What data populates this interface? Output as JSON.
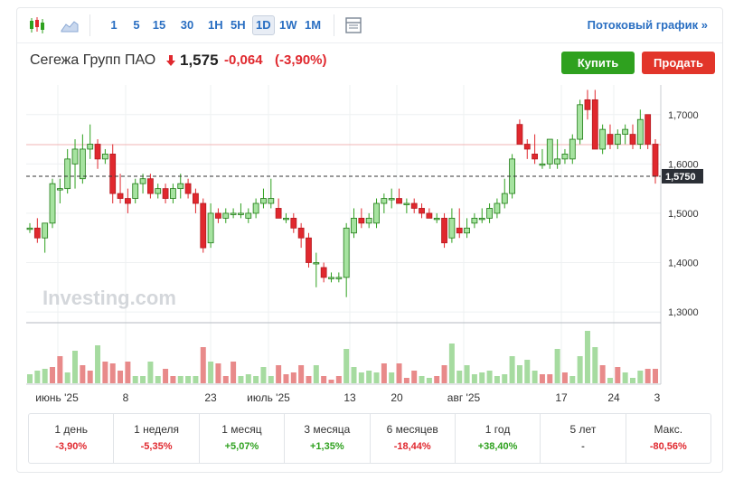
{
  "toolbar": {
    "intervals": [
      "1",
      "5",
      "15",
      "30",
      "1H",
      "5H",
      "1D",
      "1W",
      "1M"
    ],
    "active_interval": "1D",
    "stream_link": "Потоковый график »"
  },
  "quote": {
    "name": "Сегежа Групп ПАО",
    "price": "1,575",
    "change": "-0,064",
    "change_pct": "(-3,90%)",
    "buy_label": "Купить",
    "sell_label": "Продать"
  },
  "chart_data": {
    "type": "candlestick",
    "y_ticks": [
      "1,3000",
      "1,4000",
      "1,5000",
      "1,6000",
      "1,7000"
    ],
    "y_range": [
      1.28,
      1.76
    ],
    "last_price_label": "1,5750",
    "last_price": 1.575,
    "prev_close_line": 1.639,
    "x_labels": [
      "июнь '25",
      "8",
      "23",
      "июль '25",
      "13",
      "20",
      "авг '25",
      "17",
      "24",
      "3"
    ],
    "watermark": "Investing.com",
    "up_color": "#2fa11f",
    "down_color": "#e0282e",
    "candles": [
      [
        1.47,
        1.48,
        1.46,
        1.47
      ],
      [
        1.47,
        1.49,
        1.44,
        1.45
      ],
      [
        1.45,
        1.48,
        1.42,
        1.48
      ],
      [
        1.48,
        1.57,
        1.47,
        1.56
      ],
      [
        1.55,
        1.57,
        1.52,
        1.55
      ],
      [
        1.55,
        1.63,
        1.54,
        1.61
      ],
      [
        1.6,
        1.65,
        1.55,
        1.63
      ],
      [
        1.57,
        1.66,
        1.56,
        1.63
      ],
      [
        1.63,
        1.68,
        1.61,
        1.64
      ],
      [
        1.64,
        1.65,
        1.59,
        1.61
      ],
      [
        1.61,
        1.63,
        1.6,
        1.62
      ],
      [
        1.62,
        1.64,
        1.52,
        1.54
      ],
      [
        1.54,
        1.58,
        1.52,
        1.53
      ],
      [
        1.53,
        1.55,
        1.5,
        1.52
      ],
      [
        1.53,
        1.57,
        1.52,
        1.56
      ],
      [
        1.56,
        1.58,
        1.54,
        1.57
      ],
      [
        1.57,
        1.58,
        1.53,
        1.54
      ],
      [
        1.54,
        1.56,
        1.53,
        1.55
      ],
      [
        1.55,
        1.56,
        1.52,
        1.53
      ],
      [
        1.53,
        1.56,
        1.52,
        1.55
      ],
      [
        1.55,
        1.58,
        1.53,
        1.56
      ],
      [
        1.56,
        1.57,
        1.53,
        1.54
      ],
      [
        1.54,
        1.55,
        1.5,
        1.52
      ],
      [
        1.52,
        1.53,
        1.42,
        1.43
      ],
      [
        1.44,
        1.52,
        1.43,
        1.5
      ],
      [
        1.5,
        1.51,
        1.48,
        1.49
      ],
      [
        1.49,
        1.51,
        1.48,
        1.5
      ],
      [
        1.5,
        1.51,
        1.49,
        1.5
      ],
      [
        1.5,
        1.52,
        1.49,
        1.5
      ],
      [
        1.49,
        1.51,
        1.48,
        1.5
      ],
      [
        1.5,
        1.53,
        1.49,
        1.52
      ],
      [
        1.52,
        1.55,
        1.51,
        1.53
      ],
      [
        1.52,
        1.57,
        1.51,
        1.53
      ],
      [
        1.51,
        1.53,
        1.49,
        1.49
      ],
      [
        1.49,
        1.5,
        1.48,
        1.49
      ],
      [
        1.49,
        1.5,
        1.46,
        1.47
      ],
      [
        1.47,
        1.48,
        1.43,
        1.45
      ],
      [
        1.45,
        1.46,
        1.39,
        1.4
      ],
      [
        1.4,
        1.42,
        1.35,
        1.4
      ],
      [
        1.39,
        1.4,
        1.36,
        1.37
      ],
      [
        1.37,
        1.38,
        1.36,
        1.37
      ],
      [
        1.37,
        1.38,
        1.36,
        1.37
      ],
      [
        1.37,
        1.48,
        1.33,
        1.47
      ],
      [
        1.46,
        1.51,
        1.45,
        1.49
      ],
      [
        1.49,
        1.51,
        1.47,
        1.48
      ],
      [
        1.48,
        1.5,
        1.47,
        1.49
      ],
      [
        1.48,
        1.53,
        1.47,
        1.52
      ],
      [
        1.52,
        1.54,
        1.5,
        1.53
      ],
      [
        1.53,
        1.55,
        1.51,
        1.53
      ],
      [
        1.53,
        1.55,
        1.52,
        1.52
      ],
      [
        1.52,
        1.53,
        1.5,
        1.52
      ],
      [
        1.52,
        1.53,
        1.5,
        1.51
      ],
      [
        1.51,
        1.52,
        1.49,
        1.5
      ],
      [
        1.5,
        1.51,
        1.49,
        1.49
      ],
      [
        1.49,
        1.5,
        1.48,
        1.49
      ],
      [
        1.49,
        1.5,
        1.43,
        1.44
      ],
      [
        1.45,
        1.51,
        1.44,
        1.49
      ],
      [
        1.47,
        1.51,
        1.45,
        1.46
      ],
      [
        1.46,
        1.49,
        1.45,
        1.47
      ],
      [
        1.48,
        1.5,
        1.47,
        1.49
      ],
      [
        1.49,
        1.51,
        1.48,
        1.49
      ],
      [
        1.49,
        1.52,
        1.48,
        1.51
      ],
      [
        1.5,
        1.53,
        1.49,
        1.52
      ],
      [
        1.52,
        1.57,
        1.51,
        1.54
      ],
      [
        1.54,
        1.62,
        1.53,
        1.61
      ],
      [
        1.68,
        1.69,
        1.64,
        1.64
      ],
      [
        1.64,
        1.65,
        1.61,
        1.63
      ],
      [
        1.62,
        1.66,
        1.6,
        1.61
      ],
      [
        1.6,
        1.63,
        1.59,
        1.6
      ],
      [
        1.6,
        1.64,
        1.59,
        1.65
      ],
      [
        1.6,
        1.65,
        1.59,
        1.61
      ],
      [
        1.61,
        1.63,
        1.6,
        1.62
      ],
      [
        1.61,
        1.66,
        1.6,
        1.65
      ],
      [
        1.65,
        1.73,
        1.64,
        1.72
      ],
      [
        1.73,
        1.75,
        1.69,
        1.71
      ],
      [
        1.73,
        1.75,
        1.63,
        1.63
      ],
      [
        1.63,
        1.68,
        1.62,
        1.67
      ],
      [
        1.66,
        1.68,
        1.63,
        1.64
      ],
      [
        1.64,
        1.67,
        1.63,
        1.66
      ],
      [
        1.66,
        1.68,
        1.64,
        1.67
      ],
      [
        1.66,
        1.68,
        1.63,
        1.64
      ],
      [
        1.64,
        1.71,
        1.63,
        1.69
      ],
      [
        1.7,
        1.7,
        1.63,
        1.64
      ],
      [
        1.64,
        1.65,
        1.56,
        1.575
      ]
    ],
    "volumes": [
      [
        10,
        "up"
      ],
      [
        14,
        "up"
      ],
      [
        16,
        "up"
      ],
      [
        18,
        "down"
      ],
      [
        30,
        "down"
      ],
      [
        12,
        "up"
      ],
      [
        36,
        "up"
      ],
      [
        20,
        "down"
      ],
      [
        14,
        "down"
      ],
      [
        42,
        "up"
      ],
      [
        24,
        "down"
      ],
      [
        22,
        "down"
      ],
      [
        14,
        "down"
      ],
      [
        24,
        "down"
      ],
      [
        8,
        "up"
      ],
      [
        8,
        "up"
      ],
      [
        24,
        "up"
      ],
      [
        8,
        "up"
      ],
      [
        16,
        "down"
      ],
      [
        8,
        "down"
      ],
      [
        8,
        "up"
      ],
      [
        8,
        "up"
      ],
      [
        8,
        "up"
      ],
      [
        40,
        "down"
      ],
      [
        24,
        "up"
      ],
      [
        22,
        "down"
      ],
      [
        8,
        "down"
      ],
      [
        24,
        "down"
      ],
      [
        8,
        "up"
      ],
      [
        10,
        "up"
      ],
      [
        8,
        "up"
      ],
      [
        18,
        "up"
      ],
      [
        8,
        "up"
      ],
      [
        20,
        "down"
      ],
      [
        10,
        "down"
      ],
      [
        12,
        "down"
      ],
      [
        20,
        "down"
      ],
      [
        8,
        "down"
      ],
      [
        20,
        "up"
      ],
      [
        8,
        "down"
      ],
      [
        4,
        "down"
      ],
      [
        8,
        "down"
      ],
      [
        38,
        "up"
      ],
      [
        18,
        "up"
      ],
      [
        12,
        "up"
      ],
      [
        14,
        "up"
      ],
      [
        12,
        "up"
      ],
      [
        22,
        "down"
      ],
      [
        12,
        "up"
      ],
      [
        22,
        "down"
      ],
      [
        6,
        "down"
      ],
      [
        14,
        "down"
      ],
      [
        8,
        "up"
      ],
      [
        6,
        "up"
      ],
      [
        8,
        "down"
      ],
      [
        20,
        "down"
      ],
      [
        44,
        "up"
      ],
      [
        14,
        "up"
      ],
      [
        20,
        "up"
      ],
      [
        10,
        "up"
      ],
      [
        12,
        "up"
      ],
      [
        14,
        "up"
      ],
      [
        8,
        "up"
      ],
      [
        10,
        "up"
      ],
      [
        30,
        "up"
      ],
      [
        20,
        "up"
      ],
      [
        26,
        "up"
      ],
      [
        14,
        "up"
      ],
      [
        10,
        "down"
      ],
      [
        10,
        "down"
      ],
      [
        38,
        "up"
      ],
      [
        12,
        "down"
      ],
      [
        8,
        "up"
      ],
      [
        30,
        "up"
      ],
      [
        58,
        "up"
      ],
      [
        40,
        "up"
      ],
      [
        20,
        "down"
      ],
      [
        6,
        "up"
      ],
      [
        18,
        "down"
      ],
      [
        12,
        "up"
      ],
      [
        6,
        "up"
      ],
      [
        14,
        "up"
      ],
      [
        16,
        "down"
      ],
      [
        16,
        "down"
      ]
    ]
  },
  "performance": [
    {
      "label": "1 день",
      "value": "-3,90%",
      "tone": "neg"
    },
    {
      "label": "1 неделя",
      "value": "-5,35%",
      "tone": "neg"
    },
    {
      "label": "1 месяц",
      "value": "+5,07%",
      "tone": "pos"
    },
    {
      "label": "3 месяца",
      "value": "+1,35%",
      "tone": "pos"
    },
    {
      "label": "6 месяцев",
      "value": "-18,44%",
      "tone": "neg"
    },
    {
      "label": "1 год",
      "value": "+38,40%",
      "tone": "pos"
    },
    {
      "label": "5 лет",
      "value": "-",
      "tone": "neu"
    },
    {
      "label": "Макс.",
      "value": "-80,56%",
      "tone": "neg"
    }
  ]
}
